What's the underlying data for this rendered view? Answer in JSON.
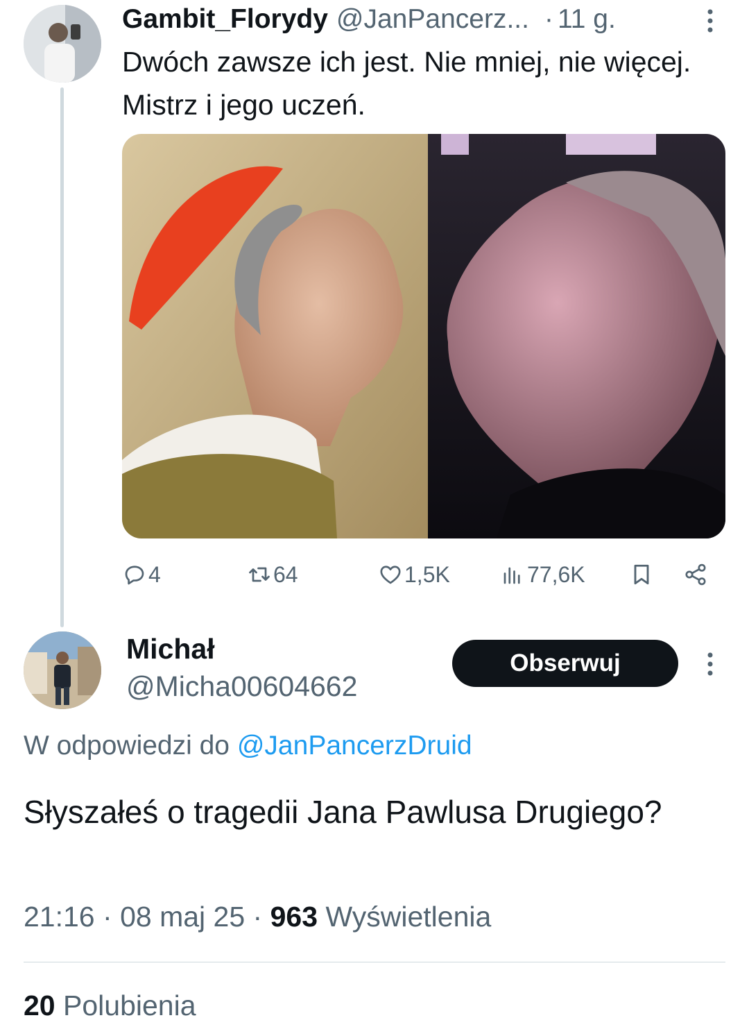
{
  "parent_tweet": {
    "author_name": "Gambit_Florydy",
    "author_handle": "@JanPancerz...",
    "separator": "·",
    "time_ago": "11 g.",
    "text": "Dwóch zawsze ich jest. Nie mniej, nie więcej. Mistrz i jego uczeń.",
    "stats": {
      "replies": "4",
      "retweets": "64",
      "likes": "1,5K",
      "views": "77,6K"
    },
    "icons": [
      "avatar",
      "more-icon",
      "reply-icon",
      "retweet-icon",
      "like-icon",
      "views-icon",
      "bookmark-icon",
      "share-icon"
    ]
  },
  "main_tweet": {
    "author_name": "Michał",
    "author_handle": "@Micha00604662",
    "follow_label": "Obserwuj",
    "reply_prefix": "W odpowiedzi do",
    "reply_mention": "@JanPancerzDruid",
    "text": "Słyszałeś o tragedii Jana Pawlusa Drugiego?",
    "time": "21:16",
    "date": "08 maj 25",
    "sep": "·",
    "views_count": "963",
    "views_label": "Wyświetlenia",
    "likes_count": "20",
    "likes_label": "Polubienia"
  },
  "colors": {
    "text": "#0f1419",
    "secondary": "#536471",
    "link": "#1d9bf0",
    "border": "#cfd9de",
    "button": "#0f1419"
  }
}
